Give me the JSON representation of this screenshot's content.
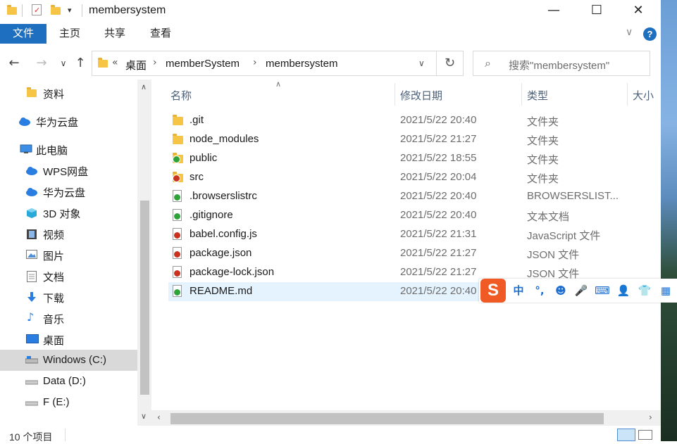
{
  "window": {
    "title": "membersystem"
  },
  "ribbon": {
    "tabs": [
      "文件",
      "主页",
      "共享",
      "查看"
    ]
  },
  "address": {
    "overflow": "«",
    "crumbs": [
      "桌面",
      "memberSystem",
      "membersystem"
    ],
    "search_placeholder": "搜索\"membersystem\""
  },
  "nav": {
    "items": [
      {
        "label": "资料",
        "icon": "folder-icon"
      },
      {
        "label": "华为云盘",
        "icon": "cloud-icon"
      },
      {
        "label": "此电脑",
        "icon": "computer-icon"
      },
      {
        "label": "WPS网盘",
        "icon": "cloud-icon"
      },
      {
        "label": "华为云盘",
        "icon": "cloud-icon"
      },
      {
        "label": "3D 对象",
        "icon": "cube-icon"
      },
      {
        "label": "视频",
        "icon": "film-icon"
      },
      {
        "label": "图片",
        "icon": "picture-icon"
      },
      {
        "label": "文档",
        "icon": "document-icon"
      },
      {
        "label": "下载",
        "icon": "download-icon"
      },
      {
        "label": "音乐",
        "icon": "music-icon"
      },
      {
        "label": "桌面",
        "icon": "desktop-icon"
      },
      {
        "label": "Windows (C:)",
        "icon": "drive-icon",
        "selected": true
      },
      {
        "label": "Data (D:)",
        "icon": "drive-icon"
      },
      {
        "label": "F (E:)",
        "icon": "drive-icon"
      }
    ]
  },
  "columns": {
    "name": "名称",
    "modified": "修改日期",
    "type": "类型",
    "size": "大小"
  },
  "files": [
    {
      "name": ".git",
      "modified": "2021/5/22 20:40",
      "type": "文件夹",
      "kind": "folder",
      "badge": ""
    },
    {
      "name": "node_modules",
      "modified": "2021/5/22 21:27",
      "type": "文件夹",
      "kind": "folder",
      "badge": ""
    },
    {
      "name": "public",
      "modified": "2021/5/22 18:55",
      "type": "文件夹",
      "kind": "folder",
      "badge": "green"
    },
    {
      "name": "src",
      "modified": "2021/5/22 20:04",
      "type": "文件夹",
      "kind": "folder",
      "badge": "red"
    },
    {
      "name": ".browserslistrc",
      "modified": "2021/5/22 20:40",
      "type": "BROWSERSLIST...",
      "kind": "file",
      "badge": "green"
    },
    {
      "name": ".gitignore",
      "modified": "2021/5/22 20:40",
      "type": "文本文档",
      "kind": "file",
      "badge": "green"
    },
    {
      "name": "babel.config.js",
      "modified": "2021/5/22 21:31",
      "type": "JavaScript 文件",
      "kind": "file",
      "badge": "red"
    },
    {
      "name": "package.json",
      "modified": "2021/5/22 21:27",
      "type": "JSON 文件",
      "kind": "file",
      "badge": "red"
    },
    {
      "name": "package-lock.json",
      "modified": "2021/5/22 21:27",
      "type": "JSON 文件",
      "kind": "file",
      "badge": "red"
    },
    {
      "name": "README.md",
      "modified": "2021/5/22 20:40",
      "type": "",
      "kind": "file",
      "badge": "green",
      "selected": true
    }
  ],
  "status": {
    "count": "10 个项目"
  },
  "ime": {
    "mode": "中",
    "punct": "°,"
  },
  "colors": {
    "accent": "#1e6fbf",
    "selected_row": "#e5f3ff",
    "sogou": "#f05a24"
  }
}
